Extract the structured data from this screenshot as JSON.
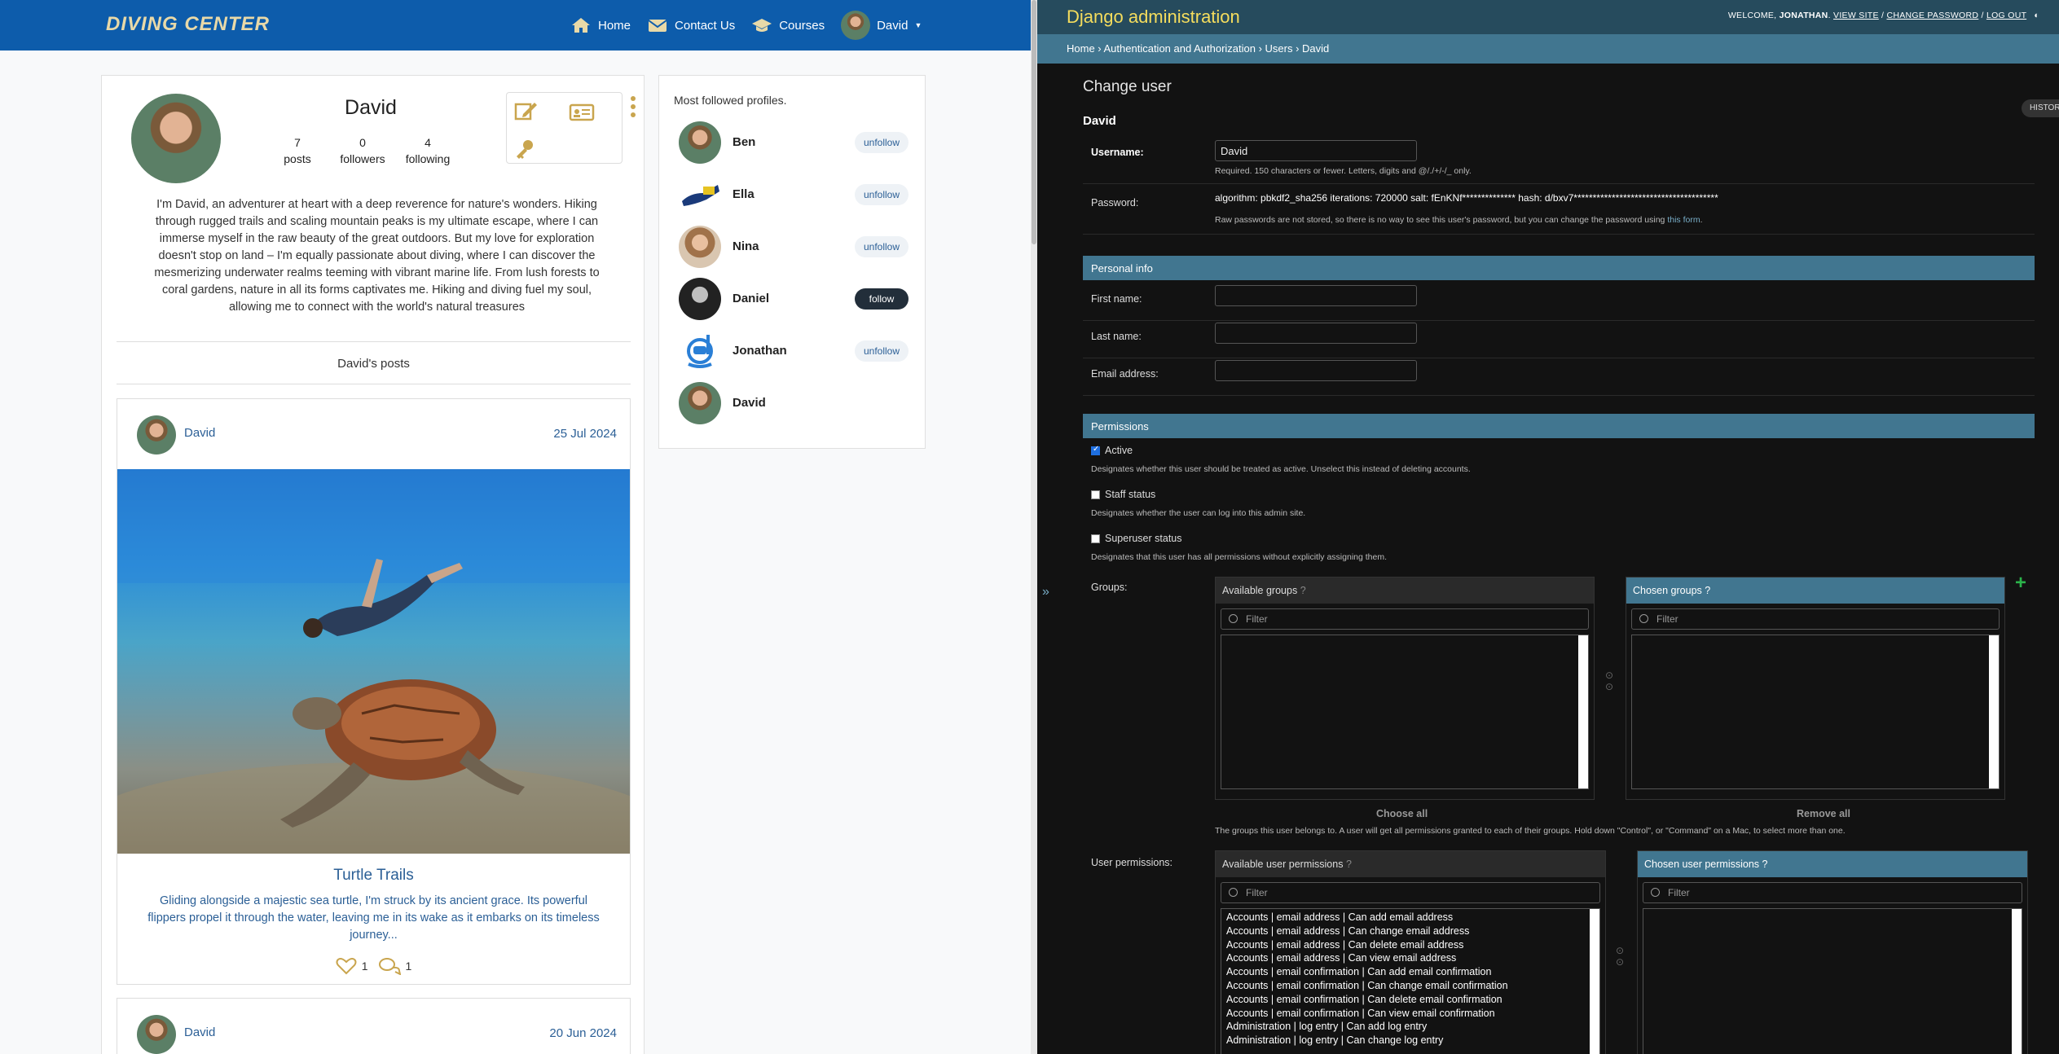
{
  "site": {
    "logo_text": "DIVING CENTER",
    "nav": [
      {
        "label": "Home",
        "icon": "home-icon"
      },
      {
        "label": "Contact Us",
        "icon": "envelope-icon"
      },
      {
        "label": "Courses",
        "icon": "graduation-cap-icon"
      }
    ],
    "user_menu": "David"
  },
  "profile": {
    "name": "David",
    "stats": [
      {
        "value": "7",
        "label": "posts"
      },
      {
        "value": "0",
        "label": "followers"
      },
      {
        "value": "4",
        "label": "following"
      }
    ],
    "bio": "I'm David, an adventurer at heart with a deep reverence for nature's wonders. Hiking through rugged trails and scaling mountain peaks is my ultimate escape, where I can immerse myself in the raw beauty of the great outdoors. But my love for exploration doesn't stop on land – I'm equally passionate about diving, where I can discover the mesmerizing underwater realms teeming with vibrant marine life. From lush forests to coral gardens, nature in all its forms captivates me. Hiking and diving fuel my soul, allowing me to connect with the world's natural treasures",
    "posts_heading": "David's posts"
  },
  "posts": [
    {
      "user": "David",
      "date": "25 Jul 2024",
      "title": "Turtle Trails",
      "text": "Gliding alongside a majestic sea turtle, I'm struck by its ancient grace. Its powerful flippers propel it through the water, leaving me in its wake as it embarks on its timeless journey...",
      "likes": "1",
      "comments": "1"
    },
    {
      "user": "David",
      "date": "20 Jun 2024"
    }
  ],
  "sidebar": {
    "title": "Most followed profiles.",
    "profiles": [
      {
        "name": "Ben",
        "button": "unfollow"
      },
      {
        "name": "Ella",
        "button": "unfollow"
      },
      {
        "name": "Nina",
        "button": "unfollow"
      },
      {
        "name": "Daniel",
        "button": "follow"
      },
      {
        "name": "Jonathan",
        "button": "unfollow"
      },
      {
        "name": "David",
        "button": ""
      }
    ]
  },
  "admin": {
    "brand": "Django administration",
    "welcome": "WELCOME,",
    "user": "JONATHAN",
    "tools": [
      "VIEW SITE",
      "CHANGE PASSWORD",
      "LOG OUT"
    ],
    "breadcrumb": "Home › Authentication and Authorization › Users › David",
    "page_title": "Change user",
    "object_name": "David",
    "history": "HISTORY",
    "username_label": "Username:",
    "username_value": "David",
    "username_help": "Required. 150 characters or fewer. Letters, digits and @/./+/-/_ only.",
    "password_label": "Password:",
    "password_value": "algorithm: pbkdf2_sha256 iterations: 720000 salt: fEnKNf************** hash: d/bxv7**************************************",
    "password_help": "Raw passwords are not stored, so there is no way to see this user's password, but you can change the password using",
    "password_link": "this form",
    "personal_info": "Personal info",
    "first_name": "First name:",
    "last_name": "Last name:",
    "email": "Email address:",
    "permissions": "Permissions",
    "active": "Active",
    "active_help": "Designates whether this user should be treated as active. Unselect this instead of deleting accounts.",
    "staff": "Staff status",
    "staff_help": "Designates whether the user can log into this admin site.",
    "superuser": "Superuser status",
    "superuser_help": "Designates that this user has all permissions without explicitly assigning them.",
    "groups_label": "Groups:",
    "available_groups": "Available groups",
    "chosen_groups": "Chosen groups",
    "filter_placeholder": "Filter",
    "choose_all": "Choose all",
    "remove_all": "Remove all",
    "groups_help": "The groups this user belongs to. A user will get all permissions granted to each of their groups. Hold down \"Control\", or \"Command\" on a Mac, to select more than one.",
    "user_perms_label": "User permissions:",
    "available_perms": "Available user permissions",
    "chosen_perms": "Chosen user permissions",
    "perm_items": [
      "Accounts | email address | Can add email address",
      "Accounts | email address | Can change email address",
      "Accounts | email address | Can delete email address",
      "Accounts | email address | Can view email address",
      "Accounts | email confirmation | Can add email confirmation",
      "Accounts | email confirmation | Can change email confirmation",
      "Accounts | email confirmation | Can delete email confirmation",
      "Accounts | email confirmation | Can view email confirmation",
      "Administration | log entry | Can add log entry",
      "Administration | log entry | Can change log entry"
    ]
  }
}
